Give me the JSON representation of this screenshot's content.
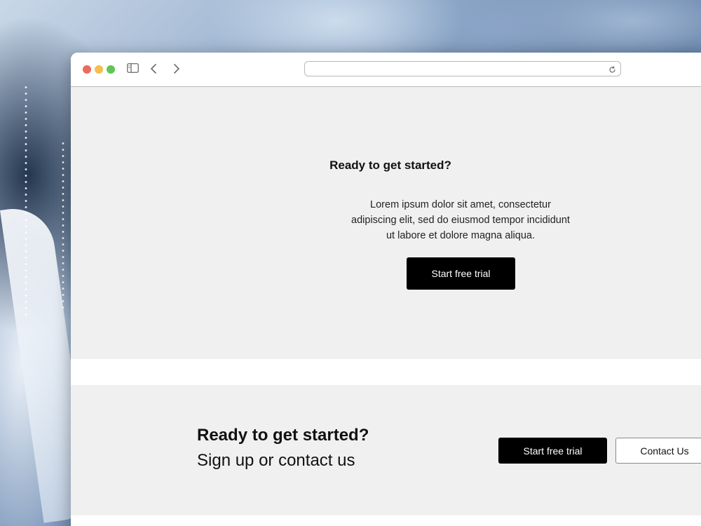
{
  "browser": {
    "address_value": "",
    "address_placeholder": "",
    "icons": {
      "sidebar": "sidebar-icon",
      "back": "chevron-left-icon",
      "forward": "chevron-right-icon",
      "reload": "reload-icon"
    },
    "traffic_lights": {
      "close": "#ec6a5e",
      "minimize": "#f4bf4f",
      "zoom": "#61c554"
    }
  },
  "hero": {
    "title": "Ready to get started?",
    "text": "Lorem ipsum dolor sit amet, consectetur adipiscing elit, sed do eiusmod tempor incididunt ut labore et dolore magna aliqua.",
    "button_label": "Start free trial"
  },
  "cta": {
    "title": "Ready to get started?",
    "subtitle": "Sign up or contact us",
    "primary_label": "Start free trial",
    "secondary_label": "Contact Us"
  },
  "colors": {
    "section_background": "#f0f0f0",
    "primary_button": "#000000",
    "primary_button_text": "#ffffff"
  }
}
